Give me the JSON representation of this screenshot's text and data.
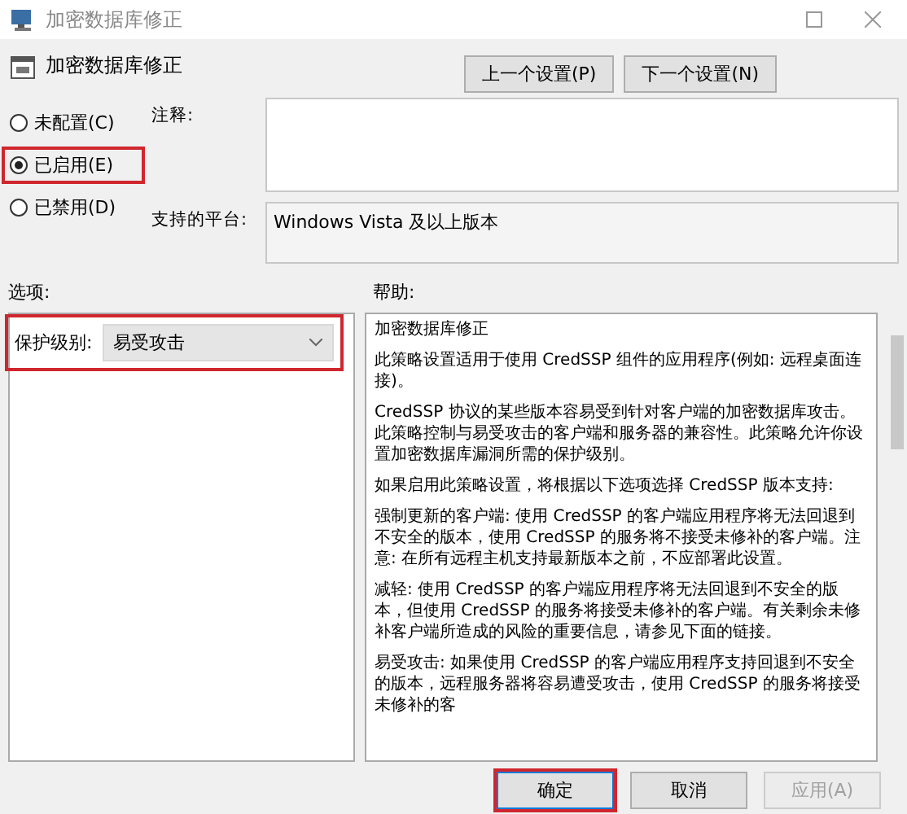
{
  "window": {
    "title": "加密数据库修正"
  },
  "policy": {
    "name": "加密数据库修正"
  },
  "nav_buttons": [
    "上一个设置(P)",
    "下一个设置(N)"
  ],
  "state_options": [
    {
      "label": "未配置(C)",
      "selected": false,
      "highlighted": false
    },
    {
      "label": "已启用(E)",
      "selected": true,
      "highlighted": true
    },
    {
      "label": "已禁用(D)",
      "selected": false,
      "highlighted": false
    }
  ],
  "comment": {
    "label": "注释:"
  },
  "platform": {
    "label": "支持的平台:",
    "value": "Windows Vista 及以上版本"
  },
  "options": {
    "label": "选项:",
    "fields": [
      {
        "label": "保护级别:",
        "value": "易受攻击",
        "highlighted": true
      }
    ]
  },
  "help": {
    "label": "帮助:",
    "paragraphs": [
      "加密数据库修正",
      "此策略设置适用于使用 CredSSP 组件的应用程序(例如: 远程桌面连接)。",
      "CredSSP 协议的某些版本容易受到针对客户端的加密数据库攻击。此策略控制与易受攻击的客户端和服务器的兼容性。此策略允许你设置加密数据库漏洞所需的保护级别。",
      "如果启用此策略设置，将根据以下选项选择 CredSSP 版本支持:",
      "强制更新的客户端: 使用 CredSSP 的客户端应用程序将无法回退到不安全的版本，使用 CredSSP 的服务将不接受未修补的客户端。注意: 在所有远程主机支持最新版本之前，不应部署此设置。",
      "减轻: 使用 CredSSP 的客户端应用程序将无法回退到不安全的版本，但使用 CredSSP 的服务将接受未修补的客户端。有关剩余未修补客户端所造成的风险的重要信息，请参见下面的链接。",
      "易受攻击: 如果使用 CredSSP 的客户端应用程序支持回退到不安全的版本，远程服务器将容易遭受攻击，使用 CredSSP 的服务将接受未修补的客"
    ]
  },
  "footer_buttons": [
    {
      "label": "确定",
      "highlighted": true,
      "disabled": false
    },
    {
      "label": "取消",
      "highlighted": false,
      "disabled": false
    },
    {
      "label": "应用(A)",
      "highlighted": false,
      "disabled": true
    }
  ]
}
